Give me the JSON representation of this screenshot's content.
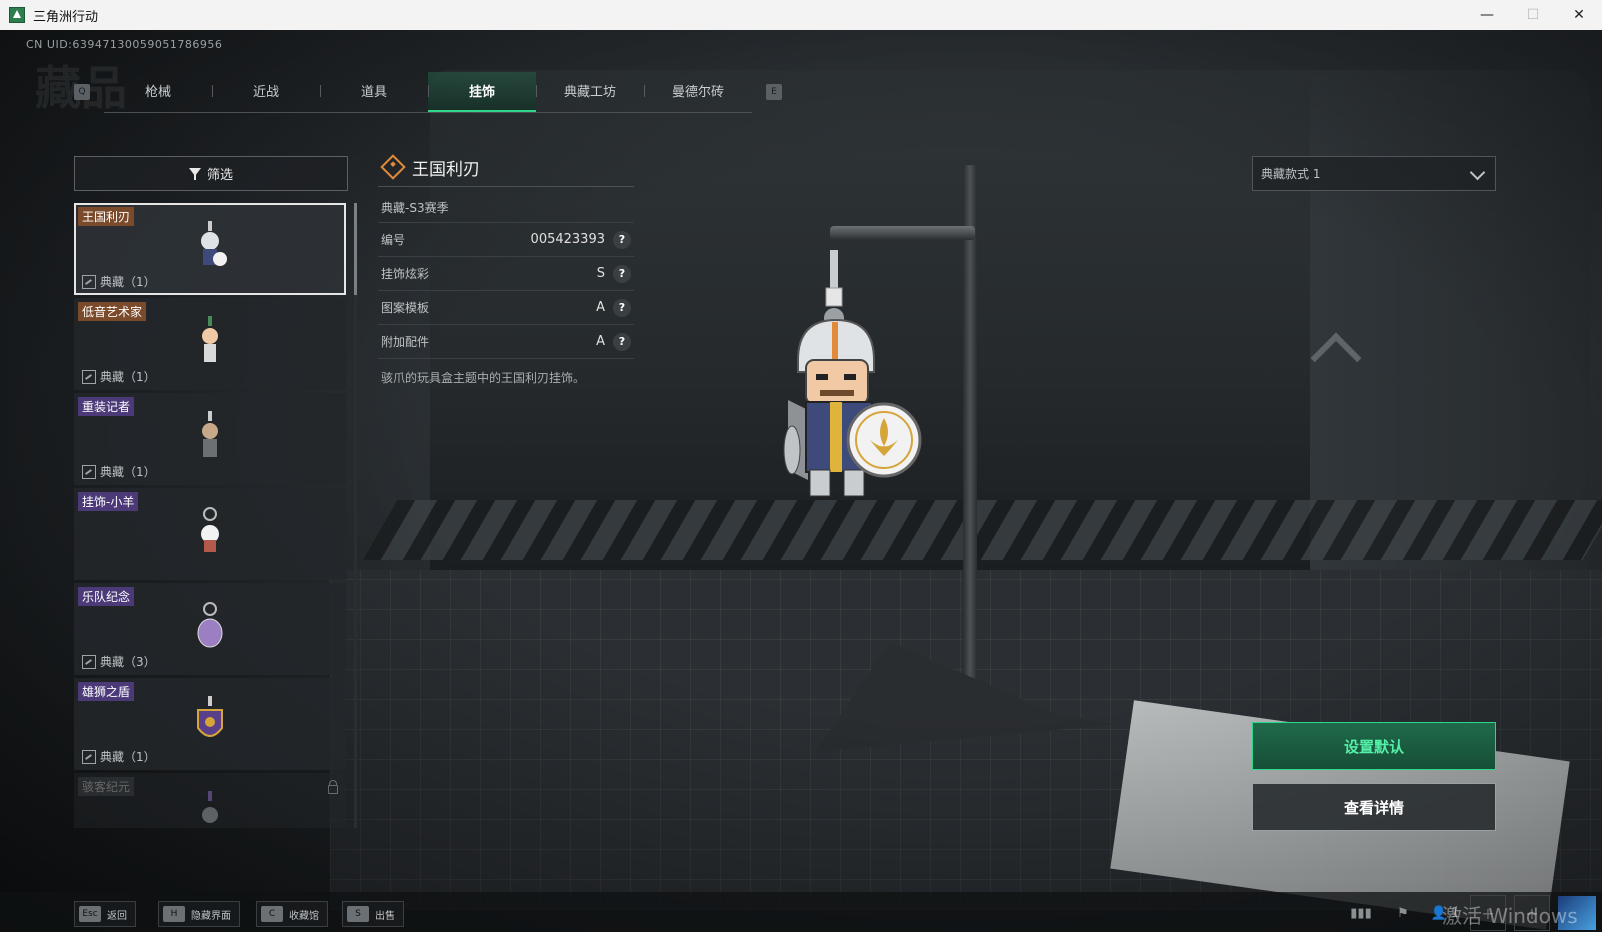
{
  "window": {
    "title": "三角洲行动",
    "minimize": "—",
    "maximize": "☐",
    "close": "✕"
  },
  "uid": "CN UID:63947130059051786956",
  "page_heading": "藏品",
  "tabs": {
    "prev_key": "Q",
    "next_key": "E",
    "items": [
      {
        "label": "枪械",
        "active": false
      },
      {
        "label": "近战",
        "active": false
      },
      {
        "label": "道具",
        "active": false
      },
      {
        "label": "挂饰",
        "active": true
      },
      {
        "label": "典藏工坊",
        "active": false
      },
      {
        "label": "曼德尔砖",
        "active": false
      }
    ]
  },
  "filter": {
    "label": "筛选"
  },
  "list": [
    {
      "name": "王国利刃",
      "count": "典藏（1）",
      "badge": "orange",
      "selected": true,
      "locked": false
    },
    {
      "name": "低音艺术家",
      "count": "典藏（1）",
      "badge": "orange",
      "selected": false,
      "locked": false
    },
    {
      "name": "重装记者",
      "count": "典藏（1）",
      "badge": "purple",
      "selected": false,
      "locked": false
    },
    {
      "name": "挂饰-小羊",
      "count": "",
      "badge": "purple",
      "selected": false,
      "locked": false
    },
    {
      "name": "乐队纪念",
      "count": "典藏（3）",
      "badge": "purple",
      "selected": false,
      "locked": false
    },
    {
      "name": "雄狮之盾",
      "count": "典藏（1）",
      "badge": "purple",
      "selected": false,
      "locked": false
    },
    {
      "name": "骇客纪元",
      "count": "",
      "badge": "gray",
      "selected": false,
      "locked": true
    }
  ],
  "detail": {
    "title": "王国利刃",
    "season": "典藏-S3赛季",
    "rows": [
      {
        "label": "编号",
        "value": "005423393"
      },
      {
        "label": "挂饰炫彩",
        "value": "S"
      },
      {
        "label": "图案模板",
        "value": "A"
      },
      {
        "label": "附加配件",
        "value": "A"
      }
    ],
    "description": "骇爪的玩具盒主题中的王国利刃挂饰。"
  },
  "style_select": {
    "value": "典藏款式 1"
  },
  "actions": {
    "set_default": "设置默认",
    "view_details": "查看详情"
  },
  "bottom_hints": [
    {
      "key": "Esc",
      "label": "返回"
    },
    {
      "key": "H",
      "label": "隐藏界面"
    },
    {
      "key": "C",
      "label": "收藏馆"
    },
    {
      "key": "S",
      "label": "出售"
    }
  ],
  "status": {
    "friends_count": "1"
  },
  "watermark": "激活 Windows",
  "colors": {
    "accent": "#2fd58a",
    "badge_orange": "#7a4a2a",
    "badge_purple": "#4c3a78"
  }
}
